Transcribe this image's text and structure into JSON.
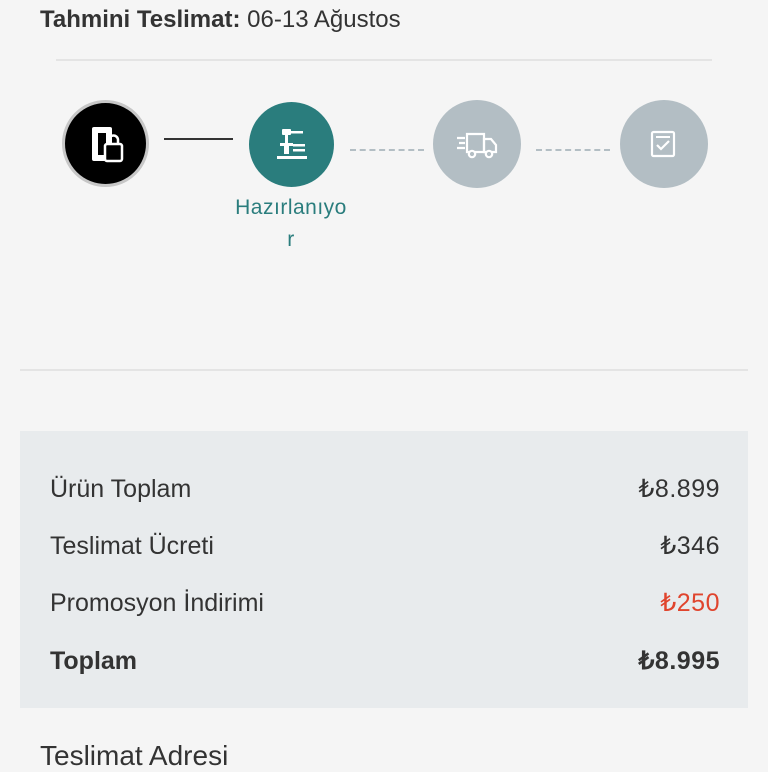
{
  "delivery": {
    "label": "Tahmini Teslimat:",
    "dates": "06-13 Ağustos"
  },
  "progress": {
    "steps": [
      {
        "icon": "order-confirmed-icon",
        "state": "done"
      },
      {
        "icon": "preparing-icon",
        "state": "active",
        "label": "Hazırlanıyor"
      },
      {
        "icon": "truck-icon",
        "state": "pending"
      },
      {
        "icon": "delivered-checklist-icon",
        "state": "pending"
      }
    ],
    "active_label_line1": "Hazırlanıyo",
    "active_label_line2": "r"
  },
  "summary": {
    "rows": [
      {
        "label": "Ürün Toplam",
        "value": "₺8.899"
      },
      {
        "label": "Teslimat Ücreti",
        "value": "₺346"
      },
      {
        "label": "Promosyon İndirimi",
        "value": "₺250"
      },
      {
        "label": "Toplam",
        "value": "₺8.995"
      }
    ]
  },
  "address": {
    "title": "Teslimat Adresi"
  },
  "colors": {
    "accent": "#2a7d7d",
    "pending": "#b3bec4",
    "discount": "#e0442d",
    "summary_bg": "#e8ebed"
  }
}
